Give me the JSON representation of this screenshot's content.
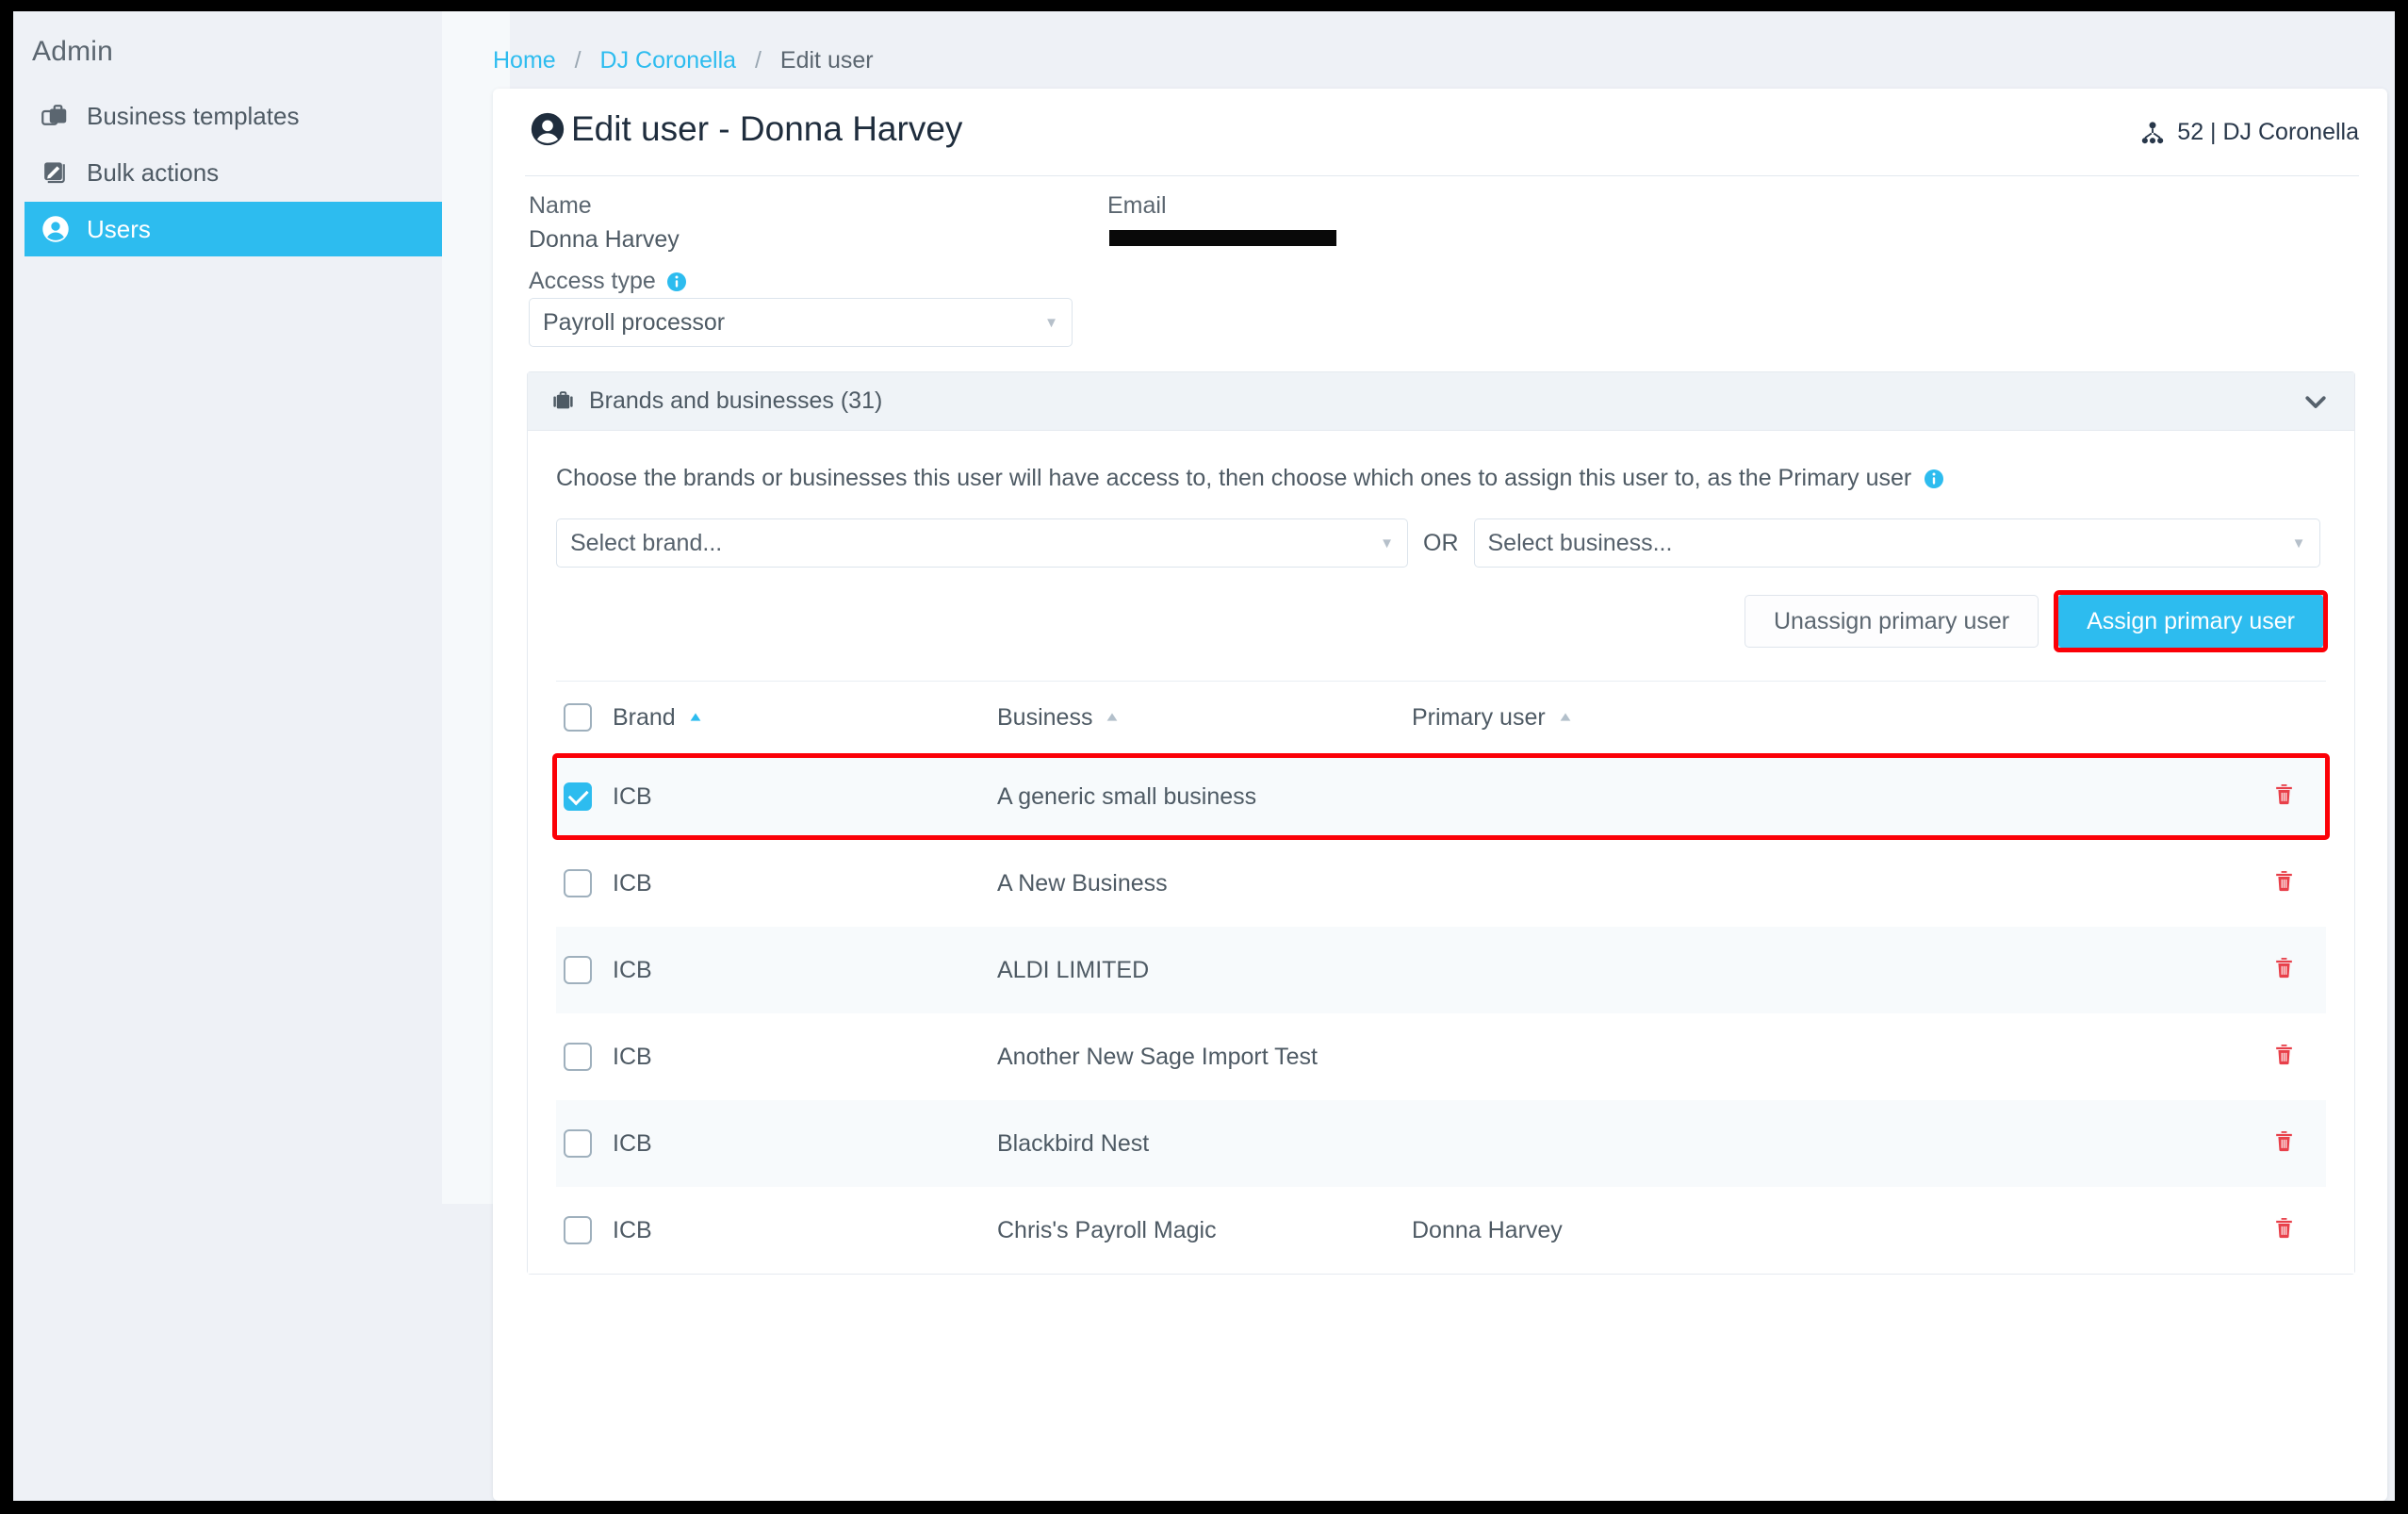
{
  "sidebar": {
    "title": "Admin",
    "items": [
      {
        "label": "Business templates",
        "icon": "briefcase-copy-icon",
        "active": false
      },
      {
        "label": "Bulk actions",
        "icon": "edit-square-icon",
        "active": false
      },
      {
        "label": "Users",
        "icon": "user-circle-icon",
        "active": true
      }
    ]
  },
  "breadcrumb": {
    "home": "Home",
    "client": "DJ Coronella",
    "current": "Edit user",
    "separator": "/"
  },
  "card": {
    "title": "Edit user - Donna Harvey",
    "title_icon": "user-circle-icon",
    "count_icon": "org-hierarchy-icon",
    "count_text": "52 | DJ Coronella"
  },
  "fields": {
    "name_label": "Name",
    "name_value": "Donna Harvey",
    "email_label": "Email",
    "email_value": "",
    "access_label": "Access type",
    "access_info_icon": "info-icon",
    "access_value": "Payroll processor",
    "access_caret": "▼"
  },
  "accordion": {
    "icon": "briefcase-icon",
    "title": "Brands and businesses (31)",
    "chevron_icon": "chevron-down-icon",
    "helper_text": "Choose the brands or businesses this user will have access to, then choose which ones to assign this user to, as the Primary user",
    "helper_info_icon": "info-icon",
    "select_brand_placeholder": "Select brand...",
    "or_label": "OR",
    "select_business_placeholder": "Select business...",
    "caret": "▼",
    "unassign_label": "Unassign primary user",
    "assign_label": "Assign primary user"
  },
  "table": {
    "headers": {
      "brand": "Brand",
      "business": "Business",
      "primary_user": "Primary user"
    },
    "sort": {
      "brand_dir": "asc",
      "brand_active": true,
      "business_dir": "asc",
      "business_active": false,
      "primary_dir": "asc",
      "primary_active": false
    },
    "delete_icon": "trash-icon",
    "rows": [
      {
        "brand": "ICB",
        "business": "A generic small business",
        "primary_user": "",
        "checked": true,
        "highlighted": true
      },
      {
        "brand": "ICB",
        "business": "A New Business",
        "primary_user": "",
        "checked": false,
        "highlighted": false
      },
      {
        "brand": "ICB",
        "business": "ALDI LIMITED",
        "primary_user": "",
        "checked": false,
        "highlighted": false
      },
      {
        "brand": "ICB",
        "business": "Another New Sage Import Test",
        "primary_user": "",
        "checked": false,
        "highlighted": false
      },
      {
        "brand": "ICB",
        "business": "Blackbird Nest",
        "primary_user": "",
        "checked": false,
        "highlighted": false
      },
      {
        "brand": "ICB",
        "business": "Chris's Payroll Magic",
        "primary_user": "Donna Harvey",
        "checked": false,
        "highlighted": false
      }
    ]
  },
  "colors": {
    "accent": "#2dbcef",
    "highlight": "#fb0007",
    "danger": "#e8404a",
    "text": "#4e5a64",
    "page_bg": "#eef1f6"
  }
}
